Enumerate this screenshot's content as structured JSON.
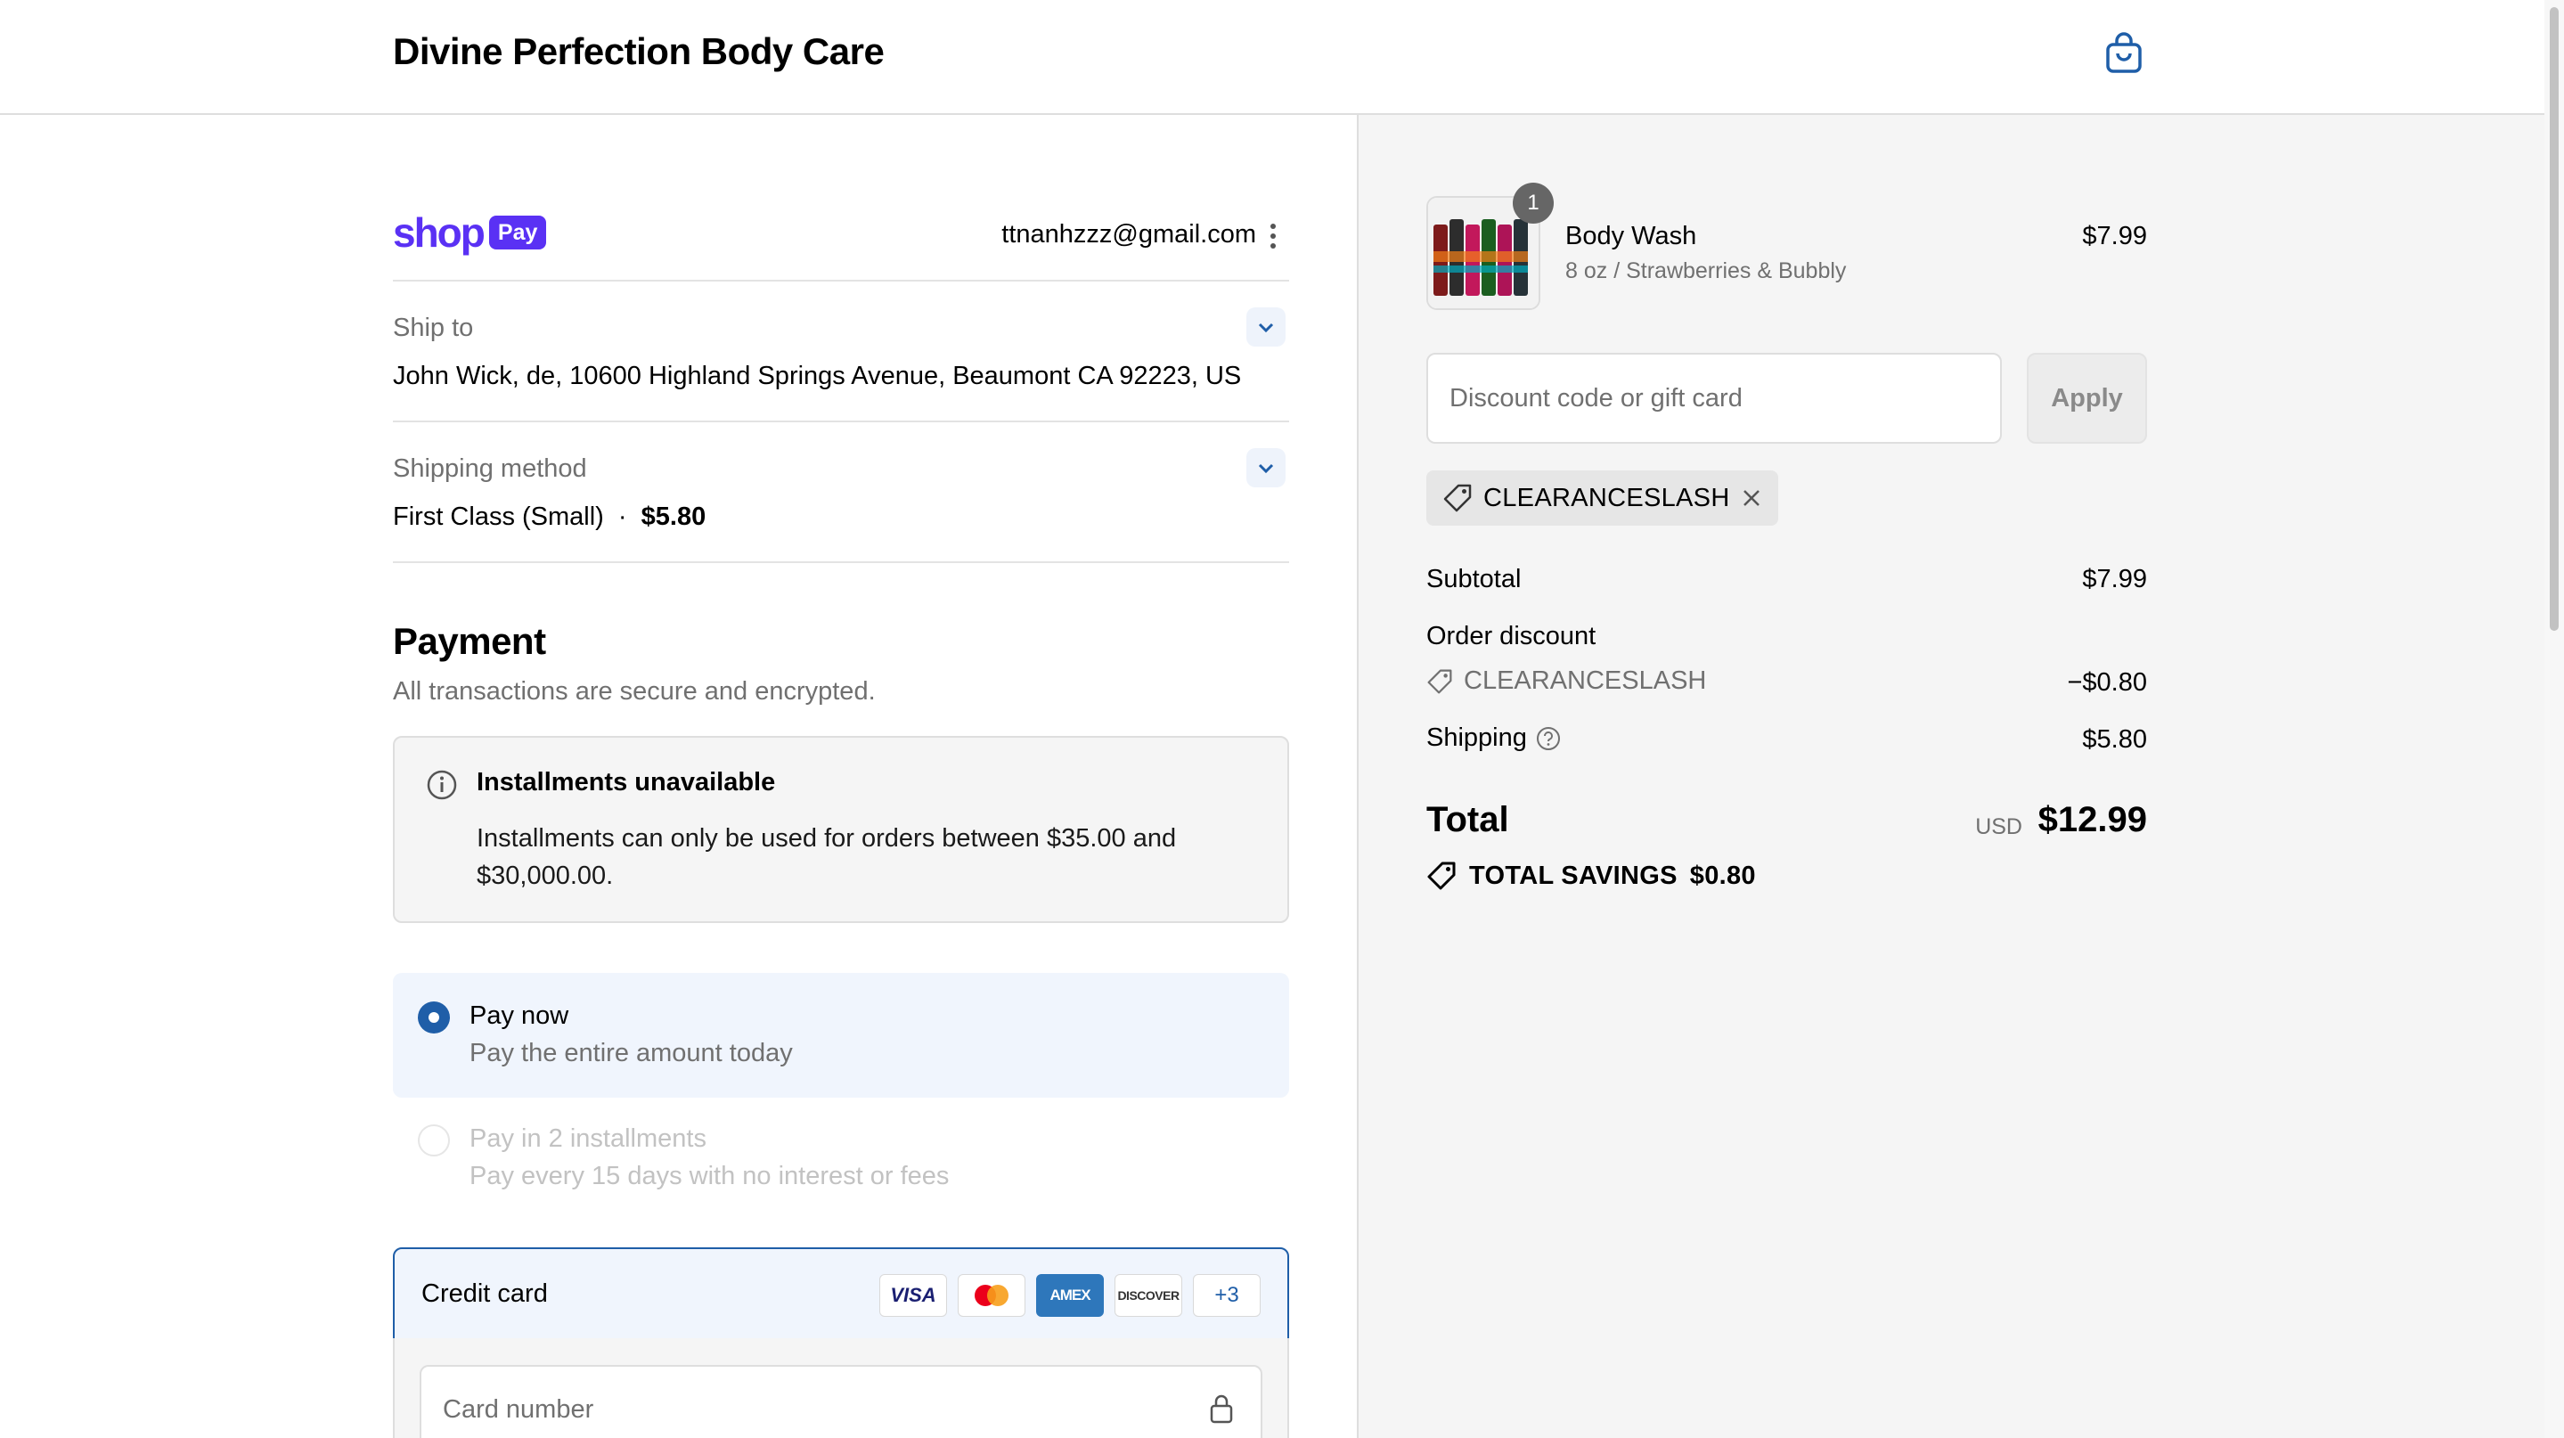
{
  "header": {
    "store_name": "Divine Perfection Body Care"
  },
  "shop_pay": {
    "logo_word": "shop",
    "logo_pill": "Pay",
    "email": "ttnanhzzz@gmail.com"
  },
  "ship_to": {
    "label": "Ship to",
    "value": "John Wick, de, 10600 Highland Springs Avenue, Beaumont CA 92223, US"
  },
  "shipping_method": {
    "label": "Shipping method",
    "name": "First Class (Small)",
    "separator": "·",
    "price": "$5.80"
  },
  "payment": {
    "heading": "Payment",
    "subheading": "All transactions are secure and encrypted.",
    "notice_title": "Installments unavailable",
    "notice_body": "Installments can only be used for orders between $35.00 and $30,000.00.",
    "options": [
      {
        "title": "Pay now",
        "subtitle": "Pay the entire amount today",
        "selected": true
      },
      {
        "title": "Pay in 2 installments",
        "subtitle": "Pay every 15 days with no interest or fees",
        "selected": false
      }
    ],
    "credit_card_label": "Credit card",
    "card_brands": [
      "VISA",
      "AMEX",
      "DISCOVER",
      "+3"
    ],
    "card_number_placeholder": "Card number"
  },
  "summary": {
    "product": {
      "quantity": "1",
      "name": "Body Wash",
      "variant": "8 oz / Strawberries & Bubbly",
      "price": "$7.99"
    },
    "discount_placeholder": "Discount code or gift card",
    "apply_label": "Apply",
    "applied_code": "CLEARANCESLASH",
    "subtotal_label": "Subtotal",
    "subtotal_value": "$7.99",
    "order_discount_label": "Order discount",
    "order_discount_code": "CLEARANCESLASH",
    "order_discount_value": "−$0.80",
    "shipping_label": "Shipping",
    "shipping_value": "$5.80",
    "total_label": "Total",
    "currency": "USD",
    "total_value": "$12.99",
    "savings_label": "TOTAL SAVINGS",
    "savings_value": "$0.80"
  },
  "colors": {
    "shop_purple": "#5a31f4",
    "accent_blue": "#1f5ea8",
    "summary_bg": "#f5f5f5"
  }
}
